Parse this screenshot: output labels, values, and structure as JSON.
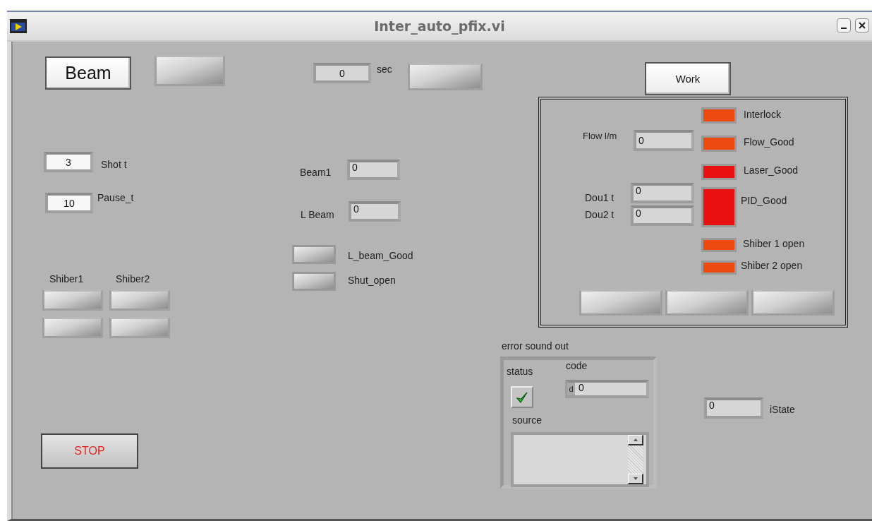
{
  "window": {
    "title": "Inter_auto_pfix.vi"
  },
  "beam_button": {
    "label": "Beam"
  },
  "timer": {
    "value": "0",
    "unit": "sec"
  },
  "shot": {
    "label": "Shot t",
    "value": "3"
  },
  "pause": {
    "label": "Pause_t",
    "value": "10"
  },
  "beam1": {
    "label": "Beam1",
    "value": "0"
  },
  "l_beam": {
    "label": "L Beam",
    "value": "0"
  },
  "indicators": [
    {
      "label": "L_beam_Good",
      "on": false
    },
    {
      "label": "Shut_open",
      "on": false
    }
  ],
  "shiber_columns": [
    "Shiber1",
    "Shiber2"
  ],
  "stop_button": {
    "label": "STOP"
  },
  "work_button": {
    "label": "Work"
  },
  "work_panel": {
    "flow": {
      "label": "Flow l/m",
      "value": "0"
    },
    "dou": [
      {
        "label": "Dou1 t",
        "value": "0"
      },
      {
        "label": "Dou2 t",
        "value": "0"
      }
    ],
    "leds": [
      {
        "label": "Interlock",
        "on": true,
        "color": "#ee4a10",
        "kind": "small"
      },
      {
        "label": "Flow_Good",
        "on": true,
        "color": "#ee4a10",
        "kind": "small"
      },
      {
        "label": "Laser_Good",
        "on": true,
        "color": "#e81010",
        "kind": "small"
      },
      {
        "label": "PID_Good",
        "on": true,
        "color": "#e81010",
        "kind": "large"
      },
      {
        "label": "Shiber 1 open",
        "on": true,
        "color": "#ee4a10",
        "kind": "small"
      },
      {
        "label": "Shiber 2 open",
        "on": true,
        "color": "#ee4a10",
        "kind": "small"
      }
    ]
  },
  "error_cluster": {
    "title": "error sound out",
    "status": {
      "label": "status",
      "checked": true
    },
    "code": {
      "label": "code",
      "radix": "d",
      "value": "0"
    },
    "source": {
      "label": "source"
    }
  },
  "istate": {
    "label": "iState",
    "value": "0"
  }
}
